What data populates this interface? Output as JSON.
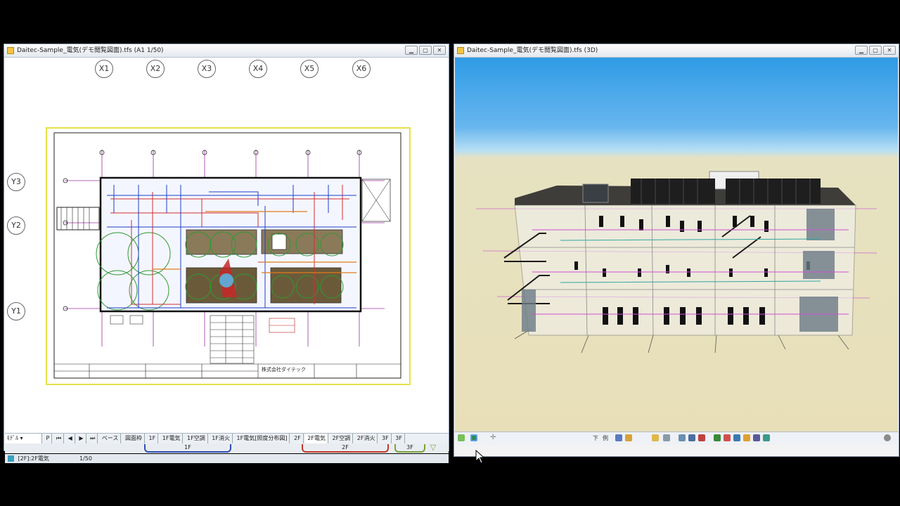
{
  "left_window": {
    "title": "Daitec-Sample_電気(デモ閲覧図面).tfs (A1 1/50)",
    "grid_x": [
      "X1",
      "X2",
      "X3",
      "X4",
      "X5",
      "X6"
    ],
    "grid_y": [
      "Y3",
      "Y2",
      "Y1"
    ],
    "company": "株式会社ダイテック",
    "view_selector": "ﾓﾃﾞﾙ",
    "tabs": [
      "ベース",
      "図面枠",
      "1F",
      "1F電気",
      "1F空調",
      "1F消火",
      "1F電気[照度分布図]",
      "2F",
      "2F電気",
      "2F空調",
      "2F消火",
      "3F",
      "3F"
    ],
    "floors": [
      "1F",
      "2F",
      "3F"
    ],
    "status_layer": "[2F]:2F電気",
    "status_scale": "1/50"
  },
  "right_window": {
    "title": "Daitec-Sample_電気(デモ閲覧図面).tfs (3D)",
    "toolbar_glyphs": [
      "下",
      "例"
    ]
  },
  "colors": {
    "floor1": "#2d4db5",
    "floor2": "#c0392b",
    "floor3": "#7ba23a",
    "sheet_border": "#e6e14a"
  }
}
